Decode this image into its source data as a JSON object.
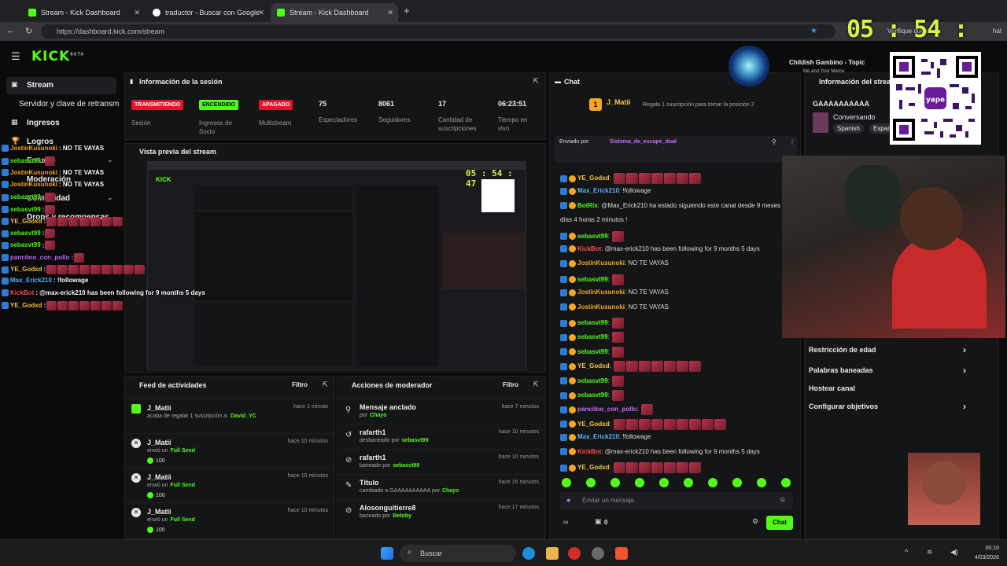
{
  "browser": {
    "tabs": [
      {
        "label": "Stream - Kick Dashboard"
      },
      {
        "label": "traductor - Buscar con Google"
      },
      {
        "label": "Stream - Kick Dashboard"
      }
    ],
    "url": "https://dashboard.kick.com/stream",
    "addr_right_text": "Verifique que es",
    "addr_right_text2": "hat"
  },
  "clock_overlay": "05 : 54 : 44",
  "sidebar": {
    "items": [
      {
        "label": "Stream"
      },
      {
        "label": "Servidor y clave de retransm"
      },
      {
        "label": "Ingresos"
      },
      {
        "label": "Logros"
      },
      {
        "label": "Estudio"
      },
      {
        "label": "Moderación"
      },
      {
        "label": "Comunidad"
      },
      {
        "label": "Drops y recompensas"
      }
    ]
  },
  "session": {
    "title": "Información de la sesión",
    "stats": [
      {
        "value": "TRANSMITIENDO",
        "label": "Sesión"
      },
      {
        "value": "ENCENDIDO",
        "label": "Ingresos de Socio"
      },
      {
        "value": "APAGADO",
        "label": "Multistream"
      },
      {
        "value": "75",
        "label": "Espectadores"
      },
      {
        "value": "8061",
        "label": "Seguidores"
      },
      {
        "value": "17",
        "label": "Cantidad de suscripciones"
      },
      {
        "value": "06:23:51",
        "label": "Tiempo en vivo"
      }
    ]
  },
  "preview": {
    "title": "Vista previa del stream",
    "mini_clock": "05 : 54 : 47"
  },
  "activity_feed": {
    "title": "Feed de actividades",
    "filter": "Filtro",
    "items": [
      {
        "name": "J_Matii",
        "line": "acaba de regalar 1 suscripción a:",
        "target": "David_YC",
        "time": "hace 1 minuto",
        "amount": ""
      },
      {
        "name": "J_Matii",
        "line": "envió un",
        "target": "Full Send",
        "time": "hace 10 minutos",
        "amount": "100"
      },
      {
        "name": "J_Matii",
        "line": "envió un",
        "target": "Full Send",
        "time": "hace 10 minutos",
        "amount": "100"
      },
      {
        "name": "J_Matii",
        "line": "envió un",
        "target": "Full Send",
        "time": "hace 10 minutos",
        "amount": "100"
      }
    ]
  },
  "mod_actions": {
    "title": "Acciones de moderador",
    "filter": "Filtro",
    "items": [
      {
        "name": "Mensaje anclado",
        "line": "por",
        "by": "Chayo",
        "time": "hace 7 minutos"
      },
      {
        "name": "rafarth1",
        "line": "desbaneado por",
        "by": "sebasvt99",
        "time": "hace 10 minutos"
      },
      {
        "name": "rafarth1",
        "line": "baneado por",
        "by": "sebasvt99",
        "time": "hace 10 minutos"
      },
      {
        "name": "Título",
        "line": "cambiado a GAAAAAAAAAA por",
        "by": "Chayo",
        "time": "hace 16 minutos"
      },
      {
        "name": "Alosonguitierre8",
        "line": "baneado por",
        "by": "Betoby",
        "time": "hace 17 minutos"
      }
    ]
  },
  "chat": {
    "title": "Chat",
    "top_gifter": "J_Matii",
    "top_gifter_count": "1",
    "gift_prompt": "Regala 1 suscripción para tomar la posición 2",
    "pinned_label": "Enviado por",
    "pinned_by": "Sistema_de_escape_dual",
    "messages": [
      {
        "user": "YE_Godxd",
        "text": "",
        "emotes": 7,
        "color": "#f5c542"
      },
      {
        "user": "Max_Erick210",
        "text": "!followage",
        "emotes": 0,
        "color": "#5ab4ff"
      },
      {
        "user": "BotRix",
        "text": "@Max_Erick210 ha estado siguiendo este canal desde 9 meses",
        "emotes": 0,
        "color": "#53fc18"
      },
      {
        "user": "",
        "text": "días 4 horas 2 minutos !",
        "emotes": 0,
        "color": "#ddd"
      },
      {
        "user": "sebasvt99",
        "text": "",
        "emotes": 1,
        "color": "#53fc18"
      },
      {
        "user": "KickBot",
        "text": "@max-erick210 has been following for 9 months 5 days",
        "emotes": 0,
        "color": "#ff4a4a"
      },
      {
        "user": "JostinKusunoki",
        "text": "NO TE VAYAS",
        "emotes": 0,
        "color": "#f5a623"
      },
      {
        "user": "sebasvt99",
        "text": "",
        "emotes": 1,
        "color": "#53fc18"
      },
      {
        "user": "JostinKusunoki",
        "text": "NO TE VAYAS",
        "emotes": 0,
        "color": "#f5a623"
      },
      {
        "user": "JostinKusunoki",
        "text": "NO TE VAYAS",
        "emotes": 0,
        "color": "#f5a623"
      },
      {
        "user": "sebasvt99",
        "text": "",
        "emotes": 1,
        "color": "#53fc18"
      },
      {
        "user": "sebasvt99",
        "text": "",
        "emotes": 1,
        "color": "#53fc18"
      },
      {
        "user": "sebasvt99",
        "text": "",
        "emotes": 1,
        "color": "#53fc18"
      },
      {
        "user": "YE_Godxd",
        "text": "",
        "emotes": 7,
        "color": "#f5c542"
      },
      {
        "user": "sebasvt99",
        "text": "",
        "emotes": 1,
        "color": "#53fc18"
      },
      {
        "user": "sebasvt99",
        "text": "",
        "emotes": 1,
        "color": "#53fc18"
      },
      {
        "user": "pancitoo_con_pollo",
        "text": "",
        "emotes": 1,
        "color": "#c86cff"
      },
      {
        "user": "YE_Godxd",
        "text": "",
        "emotes": 9,
        "color": "#f5c542"
      },
      {
        "user": "Max_Erick210",
        "text": "!followage",
        "emotes": 0,
        "color": "#5ab4ff"
      },
      {
        "user": "KickBot",
        "text": "@max-erick210 has been following for 9 months 5 days",
        "emotes": 0,
        "color": "#ff4a4a"
      },
      {
        "user": "YE_Godxd",
        "text": "",
        "emotes": 7,
        "color": "#f5c542"
      }
    ],
    "input_placeholder": "Enviar un mensaje",
    "points": "0",
    "send_label": "Chat"
  },
  "stream_info": {
    "title": "Información del stream",
    "stream_title": "GAAAAAAAAAA",
    "category": "Conversando",
    "tags": [
      "Spanish",
      "Espan"
    ]
  },
  "music": {
    "track": "Childish Gambino - Topic",
    "subtitle": "Me and Your Mama"
  },
  "qr_label": "yape",
  "settings_menu": [
    {
      "label": "Restricción de edad",
      "chevron": true
    },
    {
      "label": "Palabras baneadas",
      "chevron": true
    },
    {
      "label": "Hostear canal",
      "chevron": false
    },
    {
      "label": "Configurar objetivos",
      "chevron": true
    }
  ],
  "overlay_chat": [
    {
      "user": "JostinKusunoki",
      "text": ": NO TE VAYAS",
      "color": "#f5a623",
      "emotes": 0
    },
    {
      "user": "sebasvt99",
      "text": ":",
      "color": "#53fc18",
      "emotes": 1
    },
    {
      "user": "JostinKusunoki",
      "text": ": NO TE VAYAS",
      "color": "#f5a623",
      "emotes": 0
    },
    {
      "user": "JostinKusunoki",
      "text": ": NO TE VAYAS",
      "color": "#f5a623",
      "emotes": 0
    },
    {
      "user": "sebasvt99",
      "text": ":",
      "color": "#53fc18",
      "emotes": 1
    },
    {
      "user": "sebasvt99",
      "text": ":",
      "color": "#53fc18",
      "emotes": 1
    },
    {
      "user": "YE_Godxd",
      "text": ":",
      "color": "#f5c542",
      "emotes": 7
    },
    {
      "user": "sebasvt99",
      "text": ":",
      "color": "#53fc18",
      "emotes": 1
    },
    {
      "user": "sebasvt99",
      "text": ":",
      "color": "#53fc18",
      "emotes": 1
    },
    {
      "user": "pancitoo_con_pollo",
      "text": ":",
      "color": "#c86cff",
      "emotes": 1
    },
    {
      "user": "YE_Godxd",
      "text": ":",
      "color": "#f5c542",
      "emotes": 9
    },
    {
      "user": "Max_Erick210",
      "text": ": !followage",
      "color": "#5ab4ff",
      "emotes": 0
    },
    {
      "user": "KickBot",
      "text": ": @max-erick210 has been following for 9 months 5 days",
      "color": "#ff4a4a",
      "emotes": 0
    },
    {
      "user": "YE_Godxd",
      "text": ":",
      "color": "#f5c542",
      "emotes": 7
    }
  ],
  "taskbar": {
    "search": "Buscar",
    "time": "00:10",
    "date": "4/03/2026"
  },
  "colors": {
    "kick_green": "#53fc18",
    "live_red": "#e3132c",
    "panel": "#141517"
  }
}
